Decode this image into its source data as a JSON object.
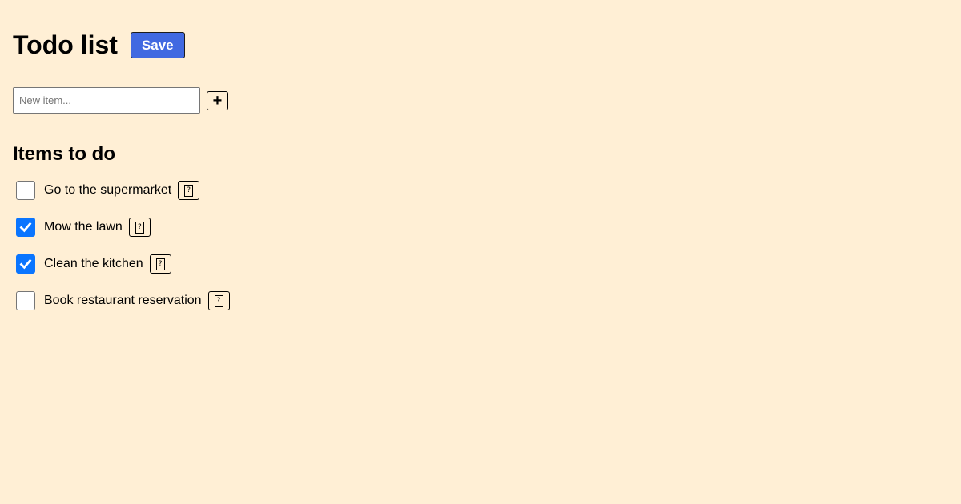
{
  "header": {
    "title": "Todo list",
    "save_label": "Save"
  },
  "new_item": {
    "placeholder": "New item...",
    "value": "",
    "add_label": "+"
  },
  "section": {
    "title": "Items to do"
  },
  "todos": [
    {
      "label": "Go to the supermarket",
      "checked": false,
      "delete_glyph": "?"
    },
    {
      "label": "Mow the lawn",
      "checked": true,
      "delete_glyph": "?"
    },
    {
      "label": "Clean the kitchen",
      "checked": true,
      "delete_glyph": "?"
    },
    {
      "label": "Book restaurant reservation",
      "checked": false,
      "delete_glyph": "?"
    }
  ],
  "colors": {
    "background": "#ffefd5",
    "save_button": "#4169e1",
    "checkbox_checked": "#0a75ff"
  },
  "icons": {
    "add": "plus-icon",
    "delete": "missing-glyph-icon",
    "check": "checkmark-icon"
  }
}
